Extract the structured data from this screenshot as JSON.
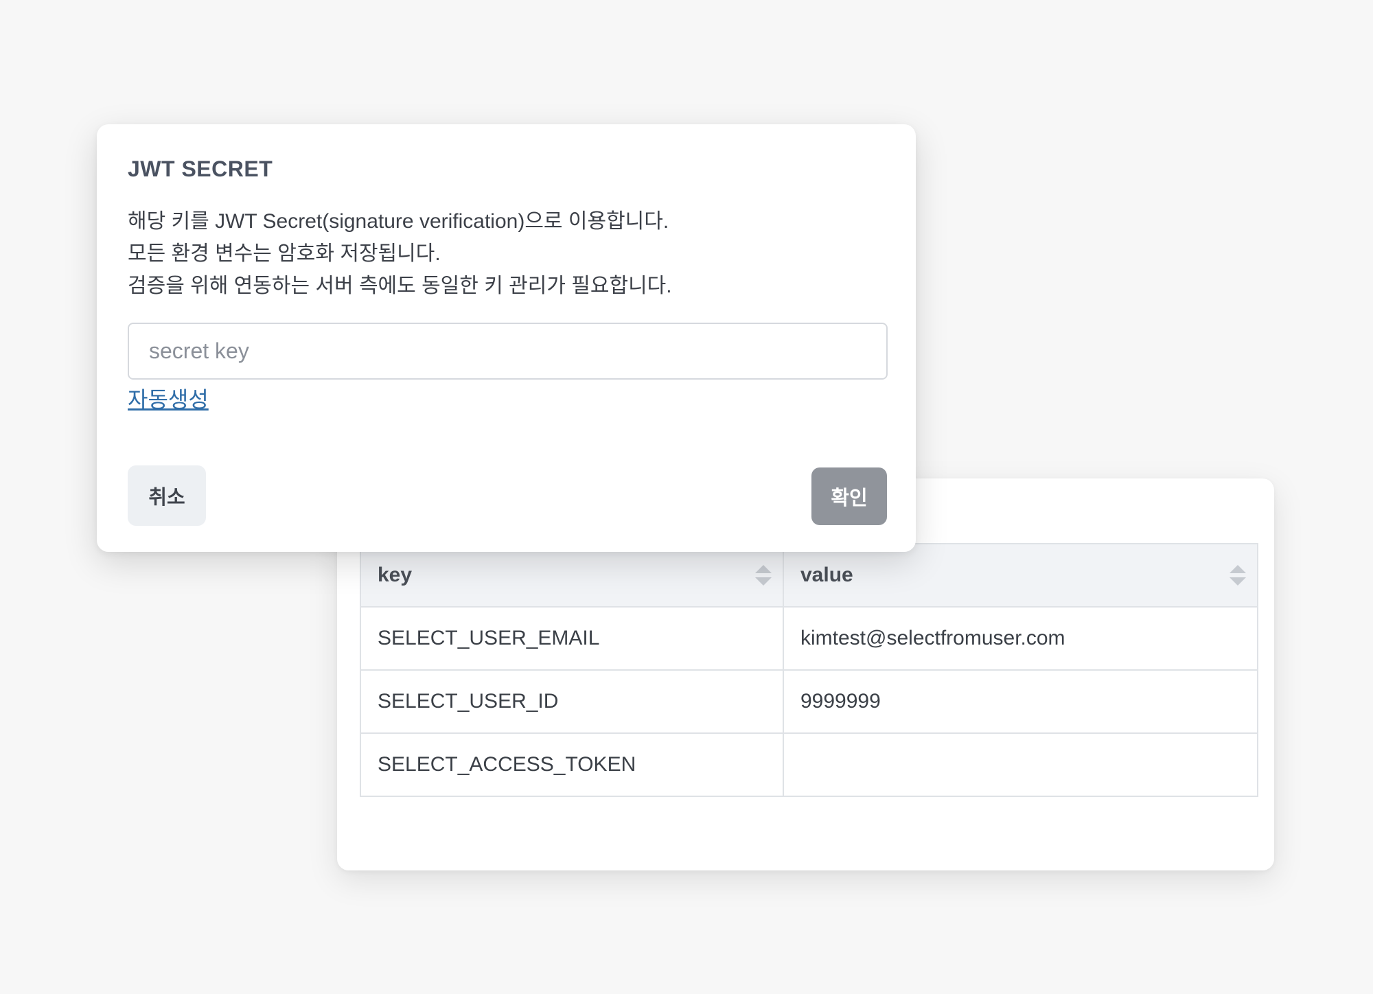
{
  "modal": {
    "title": "JWT SECRET",
    "description": [
      "해당 키를 JWT Secret(signature verification)으로 이용합니다.",
      "모든 환경 변수는 암호화 저장됩니다.",
      "검증을 위해 연동하는 서버 측에도 동일한 키 관리가 필요합니다."
    ],
    "input": {
      "value": "",
      "placeholder": "secret key"
    },
    "auto_generate_label": "자동생성",
    "cancel_label": "취소",
    "confirm_label": "확인"
  },
  "table": {
    "headers": [
      "key",
      "value"
    ],
    "rows": [
      {
        "key": "SELECT_USER_EMAIL",
        "value": "kimtest@selectfromuser.com"
      },
      {
        "key": "SELECT_USER_ID",
        "value": "9999999"
      },
      {
        "key": "SELECT_ACCESS_TOKEN",
        "value": ""
      }
    ]
  },
  "icons": {
    "sort": "sort-icon"
  },
  "colors": {
    "link": "#2f6da8",
    "confirm_button": "#90949b",
    "cancel_button": "#edf0f3",
    "table_header": "#f1f3f6"
  }
}
